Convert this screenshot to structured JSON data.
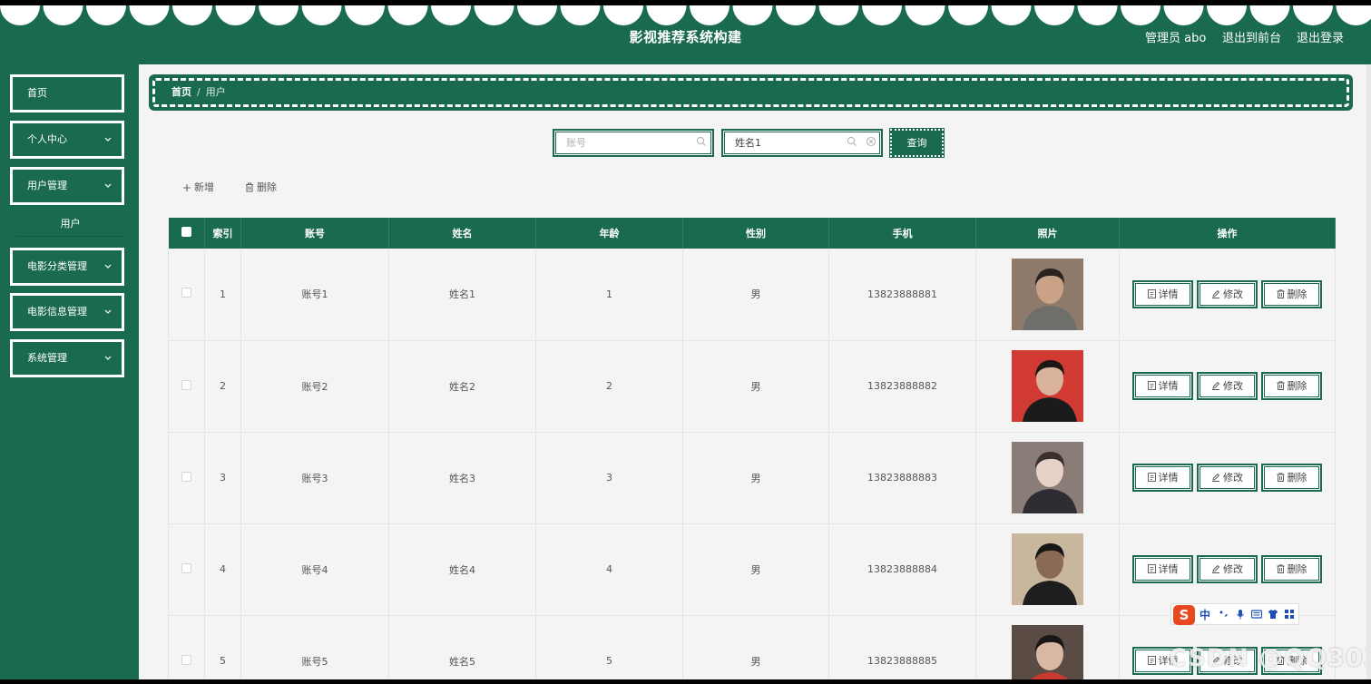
{
  "header": {
    "site_title": "影视推荐系统构建",
    "admin_label": "管理员 abo",
    "back_to_front": "退出到前台",
    "logout": "退出登录"
  },
  "sidebar": {
    "items": [
      {
        "label": "首页",
        "has_arrow": false
      },
      {
        "label": "个人中心",
        "has_arrow": true
      },
      {
        "label": "用户管理",
        "has_arrow": true
      },
      {
        "label": "电影分类管理",
        "has_arrow": true
      },
      {
        "label": "电影信息管理",
        "has_arrow": true
      },
      {
        "label": "系统管理",
        "has_arrow": true
      }
    ],
    "sub_item": "用户"
  },
  "breadcrumb": {
    "home": "首页",
    "separator": "/",
    "current": "用户"
  },
  "search": {
    "account_placeholder": "账号",
    "name_value": "姓名1",
    "query_label": "查询"
  },
  "toolbar": {
    "add_label": "新增",
    "delete_label": "删除"
  },
  "table": {
    "columns": [
      "索引",
      "账号",
      "姓名",
      "年龄",
      "性别",
      "手机",
      "照片",
      "操作"
    ],
    "rows": [
      {
        "index": "1",
        "account": "账号1",
        "name": "姓名1",
        "age": "1",
        "gender": "男",
        "phone": "13823888881"
      },
      {
        "index": "2",
        "account": "账号2",
        "name": "姓名2",
        "age": "2",
        "gender": "男",
        "phone": "13823888882"
      },
      {
        "index": "3",
        "account": "账号3",
        "name": "姓名3",
        "age": "3",
        "gender": "男",
        "phone": "13823888883"
      },
      {
        "index": "4",
        "account": "账号4",
        "name": "姓名4",
        "age": "4",
        "gender": "男",
        "phone": "13823888884"
      },
      {
        "index": "5",
        "account": "账号5",
        "name": "姓名5",
        "age": "5",
        "gender": "男",
        "phone": "13823888885"
      }
    ],
    "actions": {
      "detail": "详情",
      "edit": "修改",
      "delete": "删除"
    }
  },
  "ime": {
    "logo": "S",
    "mode": "中"
  },
  "watermark": "CSDN @QQ3030",
  "colors": {
    "primary": "#1a6a52",
    "background": "#f4f4f4"
  }
}
